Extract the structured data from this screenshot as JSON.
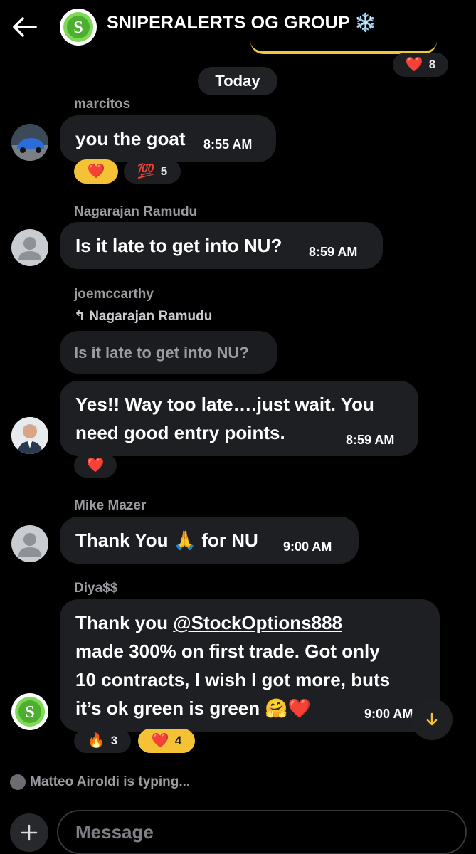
{
  "header": {
    "title": "SNIPERALERTS OG GROUP ❄️",
    "back_icon": "back-arrow-icon",
    "previous_reaction": {
      "emoji": "❤️",
      "count": "8"
    }
  },
  "day_separator": "Today",
  "messages": [
    {
      "sender": "marcitos",
      "text": "you the goat",
      "time": "8:55 AM",
      "reactions": [
        {
          "emoji": "❤️",
          "count": "",
          "mine": true
        },
        {
          "emoji": "💯",
          "count": "5",
          "mine": false
        }
      ]
    },
    {
      "sender": "Nagarajan Ramudu",
      "text": "Is it late to get into NU?",
      "time": "8:59 AM"
    },
    {
      "sender": "joemccarthy",
      "reply_to": "Nagarajan Ramudu",
      "reply_arrow": "↰",
      "quoted": "Is it late to get into NU?",
      "text_line1": "Yes!! Way too late….just wait. You",
      "text_line2": "need good entry points.",
      "time": "8:59 AM",
      "reactions": [
        {
          "emoji": "❤️",
          "count": "",
          "mine": false
        }
      ]
    },
    {
      "sender": "Mike Mazer",
      "text_pre": "Thank You",
      "emoji": "🙏",
      "text_post": "for NU",
      "time": "9:00 AM"
    },
    {
      "sender": "Diya$$",
      "line1_pre": "Thank you ",
      "mention": "@StockOptions888",
      "line2": "made 300% on first trade. Got only",
      "line3": "10 contracts, I wish I got more, buts",
      "line4": "it’s ok green is green 🤗❤️",
      "time": "9:00 AM",
      "reactions": [
        {
          "emoji": "🔥",
          "count": "3",
          "mine": false
        },
        {
          "emoji": "❤️",
          "count": "4",
          "mine": true
        }
      ]
    }
  ],
  "typing_indicator": "Matteo Airoldi is typing...",
  "composer": {
    "placeholder": "Message",
    "plus_icon": "plus-icon"
  },
  "colors": {
    "background": "#000000",
    "bubble": "#1d1f23",
    "accent_yellow": "#f4c234",
    "muted_text": "#9a9ca0"
  }
}
